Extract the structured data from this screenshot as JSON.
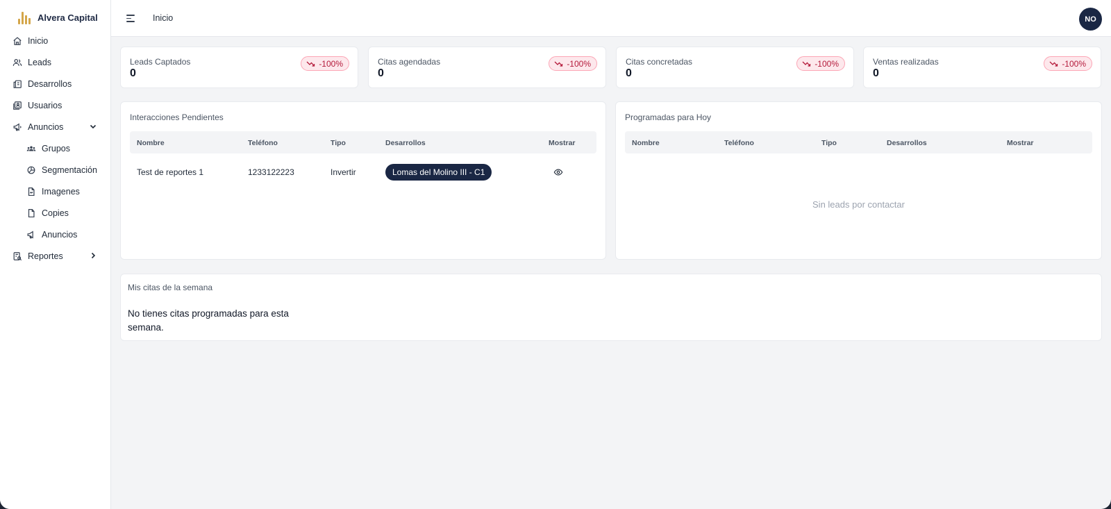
{
  "brand": {
    "name": "Alvera Capital",
    "logo_color": "#d4a64a"
  },
  "sidebar": {
    "items": [
      {
        "label": "Inicio",
        "icon": "home-icon"
      },
      {
        "label": "Leads",
        "icon": "users-icon"
      },
      {
        "label": "Desarrollos",
        "icon": "buildings-icon"
      },
      {
        "label": "Usuarios",
        "icon": "user-list-icon"
      },
      {
        "label": "Anuncios",
        "icon": "megaphone-icon",
        "expanded": true
      },
      {
        "label": "Grupos",
        "icon": "group-icon"
      },
      {
        "label": "Segmentación",
        "icon": "pie-chart-icon"
      },
      {
        "label": "Imagenes",
        "icon": "image-file-icon"
      },
      {
        "label": "Copies",
        "icon": "copy-file-icon"
      },
      {
        "label": "Anuncios",
        "icon": "megaphone-icon"
      },
      {
        "label": "Reportes",
        "icon": "report-icon",
        "expanded": false
      }
    ]
  },
  "header": {
    "title": "Inicio",
    "avatar_initials": "NO"
  },
  "stats": [
    {
      "label": "Leads Captados",
      "value": "0",
      "change": "-100%"
    },
    {
      "label": "Citas agendadas",
      "value": "0",
      "change": "-100%"
    },
    {
      "label": "Citas concretadas",
      "value": "0",
      "change": "-100%"
    },
    {
      "label": "Ventas realizadas",
      "value": "0",
      "change": "-100%"
    }
  ],
  "pending": {
    "title": "Interacciones Pendientes",
    "columns": [
      "Nombre",
      "Teléfono",
      "Tipo",
      "Desarrollos",
      "Mostrar"
    ],
    "rows": [
      {
        "nombre": "Test de reportes 1",
        "telefono": "1233122223",
        "tipo": "Invertir",
        "desarrollo": "Lomas del Molino III - C1"
      }
    ]
  },
  "today": {
    "title": "Programadas para Hoy",
    "columns": [
      "Nombre",
      "Teléfono",
      "Tipo",
      "Desarrollos",
      "Mostrar"
    ],
    "empty_message": "Sin leads por contactar"
  },
  "week": {
    "title": "Mis citas de la semana",
    "message": "No tienes citas programadas para esta semana."
  },
  "colors": {
    "accent_dark": "#1a2744",
    "negative": "#b4193a",
    "negative_bg": "#fde8ec"
  }
}
